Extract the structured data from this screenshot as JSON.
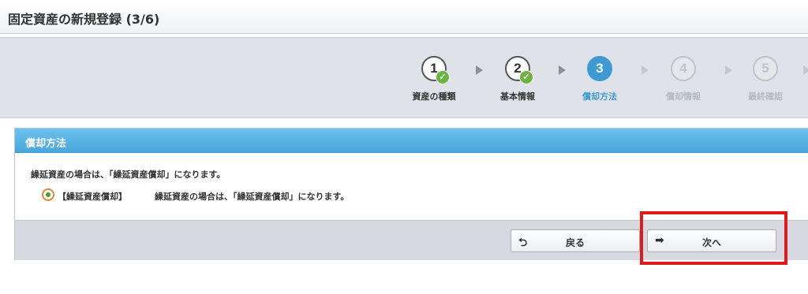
{
  "window": {
    "title": "固定資産の新規登録 (3/6)"
  },
  "steps": [
    {
      "number": "1",
      "label": "資産の種類",
      "state": "done"
    },
    {
      "number": "2",
      "label": "基本情報",
      "state": "done"
    },
    {
      "number": "3",
      "label": "償却方法",
      "state": "active"
    },
    {
      "number": "4",
      "label": "償却情報",
      "state": "future"
    },
    {
      "number": "5",
      "label": "最終確認",
      "state": "future"
    }
  ],
  "colors": {
    "accent": "#3f9ad2",
    "check": "#6db33f",
    "highlight": "#e0191d",
    "radio_ring": "#e08a33"
  },
  "panel": {
    "title": "償却方法",
    "description": "繰延資産の場合は、「繰延資産償却」になります。",
    "option": {
      "label": "【繰延資産償却】",
      "description": "繰延資産の場合は、「繰延資産償却」になります。",
      "selected": true
    }
  },
  "buttons": {
    "back_label": "戻る",
    "back_icon": "return-arrow-icon",
    "next_label": "次へ",
    "next_icon": "right-arrow-icon"
  }
}
